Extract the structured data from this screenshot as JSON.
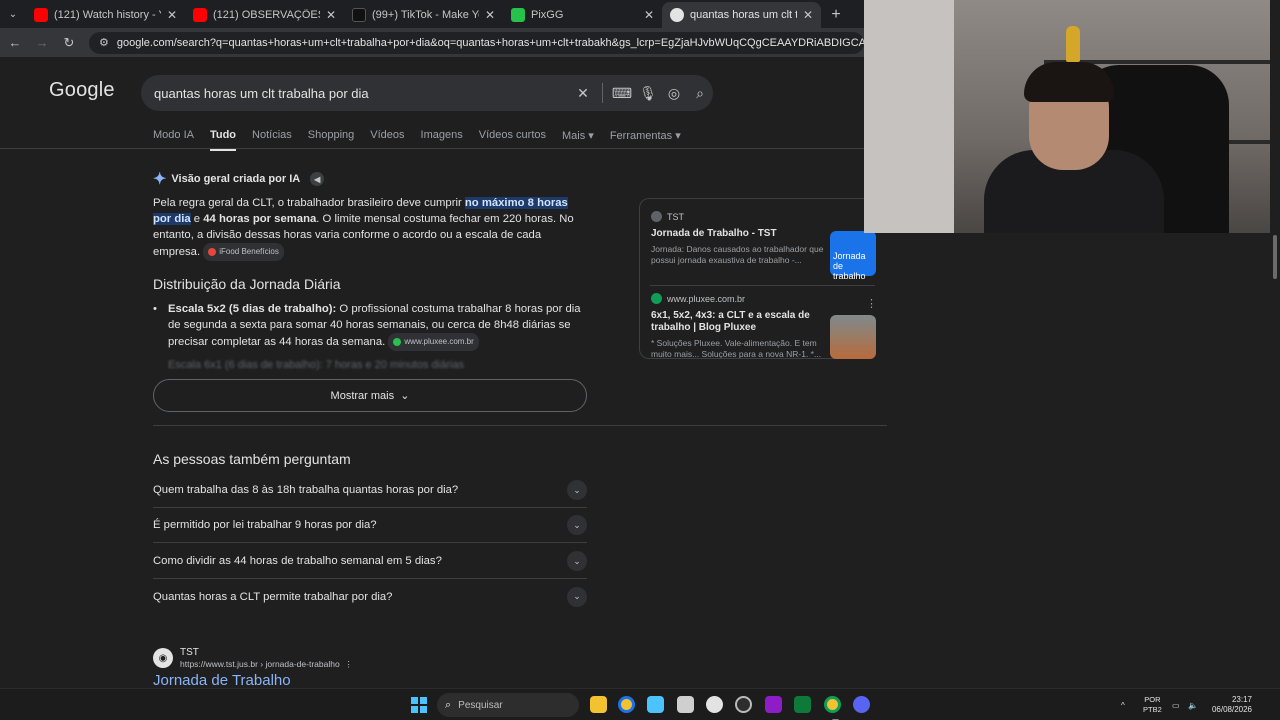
{
  "browser": {
    "tabs": [
      {
        "title": "(121) Watch history - YouTube",
        "color": "#ff0000"
      },
      {
        "title": "(121) OBSERVAÇÕES DIÁRIAS (|",
        "color": "#ff0000"
      },
      {
        "title": "(99+) TikTok - Make Your D",
        "color": "#111111"
      },
      {
        "title": "PixGG",
        "color": "#27c24c"
      },
      {
        "title": "quantas horas um clt trabalha p",
        "color": "#e3e3e3"
      }
    ],
    "url": "google.com/search?q=quantas+horas+um+clt+trabalha+por+dia&oq=quantas+horas+um+clt+trabakh&gs_lcrp=EgZjaHJvbWUqCQgCEAAYDRiABDIGCAAQRRg5MgkIARAAGA0YgAQ"
  },
  "google": {
    "logo": "Google",
    "query": "quantas horas um clt trabalha por dia",
    "tabs": [
      "Modo IA",
      "Tudo",
      "Notícias",
      "Shopping",
      "Vídeos",
      "Imagens",
      "Vídeos curtos",
      "Mais",
      "Ferramentas"
    ]
  },
  "ai_overview": {
    "heading": "Visão geral criada por IA",
    "p_start": "Pela regra geral da CLT, o trabalhador brasileiro deve cumprir ",
    "p_hl": "no máximo 8 horas por dia",
    "p_mid": " e ",
    "p_bold": "44 horas por semana",
    "p_end": ". O limite mensal costuma fechar em 220 horas. No entanto, a divisão dessas horas varia conforme o acordo ou a escala de cada empresa.",
    "chip1": "iFood Benefícios",
    "h2": "Distribuição da Jornada Diária",
    "bullet_bold": "Escala 5x2 (5 dias de trabalho):",
    "bullet_text": " O profissional costuma trabalhar 8 horas por dia de segunda a sexta para somar 40 horas semanais, ou cerca de 8h48 diárias se precisar completar as 44 horas da semana.",
    "chip2": "www.pluxee.com.br",
    "faded": "Escala 6x1 (6 dias de trabalho): 7 horas e 20 minutos diárias",
    "more_label": "Mostrar mais"
  },
  "sources": [
    {
      "site": "TST",
      "title": "Jornada de Trabalho - TST",
      "desc": "Jornada: Danos causados ao trabalhador que possui jornada exaustiva de trabalho -...",
      "thumb": "Jornada de trabalho"
    },
    {
      "site": "www.pluxee.com.br",
      "title": "6x1, 5x2, 4x3: a CLT e a escala de trabalho | Blog Pluxee",
      "desc": "* Soluções Pluxee. Vale-alimentação. E tem muito mais... Soluções para a nova NR-1. *..."
    }
  ],
  "paa": {
    "title": "As pessoas também perguntam",
    "questions": [
      "Quem trabalha das 8 às 18h trabalha quantas horas por dia?",
      "É permitido por lei trabalhar 9 horas por dia?",
      "Como dividir as 44 horas de trabalho semanal em 5 dias?",
      "Quantas horas a CLT permite trabalhar por dia?"
    ]
  },
  "result": {
    "site": "TST",
    "url": "https://www.tst.jus.br › jornada-de-trabalho",
    "title": "Jornada de Trabalho"
  },
  "taskbar": {
    "search_placeholder": "Pesquisar",
    "lang1": "POR",
    "lang2": "PTB2",
    "time": "23:17",
    "date": "06/08/2026"
  }
}
